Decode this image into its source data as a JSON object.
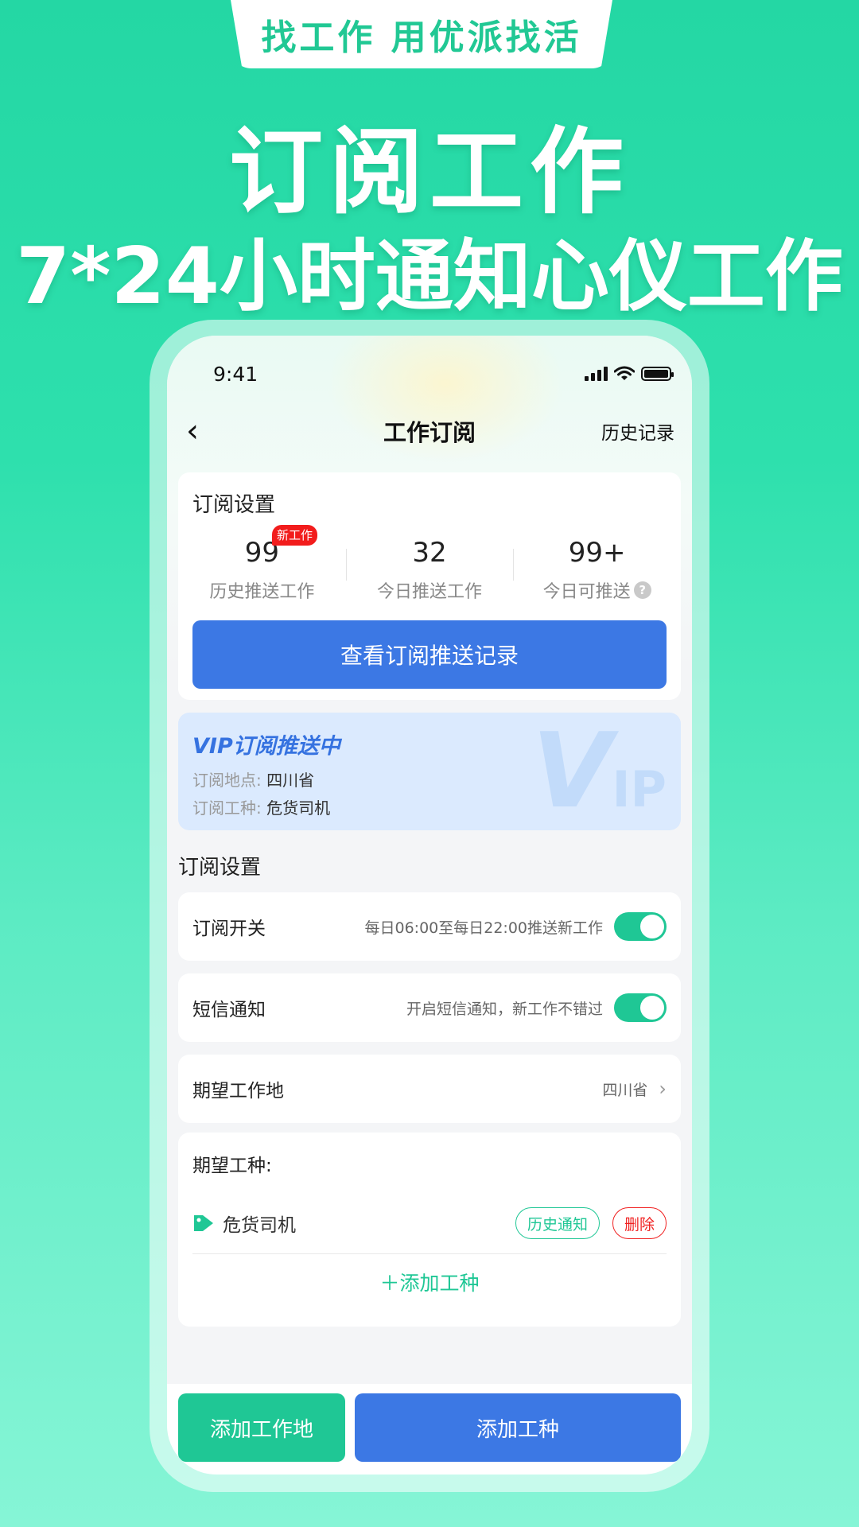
{
  "promo": {
    "tab_text": "找工作 用优派找活",
    "headline1": "订阅工作",
    "headline2": "7*24小时通知心仪工作"
  },
  "status_bar": {
    "time": "9:41"
  },
  "nav": {
    "back": "‹",
    "title": "工作订阅",
    "history": "历史记录"
  },
  "stats_card": {
    "title": "订阅设置",
    "new_badge": "新工作",
    "stats": [
      {
        "value": "99",
        "label": "历史推送工作"
      },
      {
        "value": "32",
        "label": "今日推送工作"
      },
      {
        "value": "99+",
        "label": "今日可推送"
      }
    ],
    "help_icon": "?",
    "view_button": "查看订阅推送记录"
  },
  "vip_card": {
    "title": "VIP订阅推送中",
    "location_label": "订阅地点:",
    "location_value": "四川省",
    "job_label": "订阅工种:",
    "job_value": "危货司机",
    "watermark_v": "V",
    "watermark_ip": "IP"
  },
  "settings": {
    "heading": "订阅设置",
    "subscribe_switch": {
      "label": "订阅开关",
      "desc": "每日06:00至每日22:00推送新工作",
      "on": true
    },
    "sms_switch": {
      "label": "短信通知",
      "desc": "开启短信通知，新工作不错过",
      "on": true
    },
    "location": {
      "label": "期望工作地",
      "value": "四川省",
      "chevron": "›"
    }
  },
  "jobs": {
    "title": "期望工种:",
    "items": [
      {
        "name": "危货司机",
        "history_btn": "历史通知",
        "delete_btn": "删除"
      }
    ],
    "add_label": "＋添加工种"
  },
  "bottom": {
    "add_location": "添加工作地",
    "add_job": "添加工种"
  },
  "colors": {
    "green": "#1fc795",
    "blue": "#3c78e4",
    "red": "#f02020"
  }
}
